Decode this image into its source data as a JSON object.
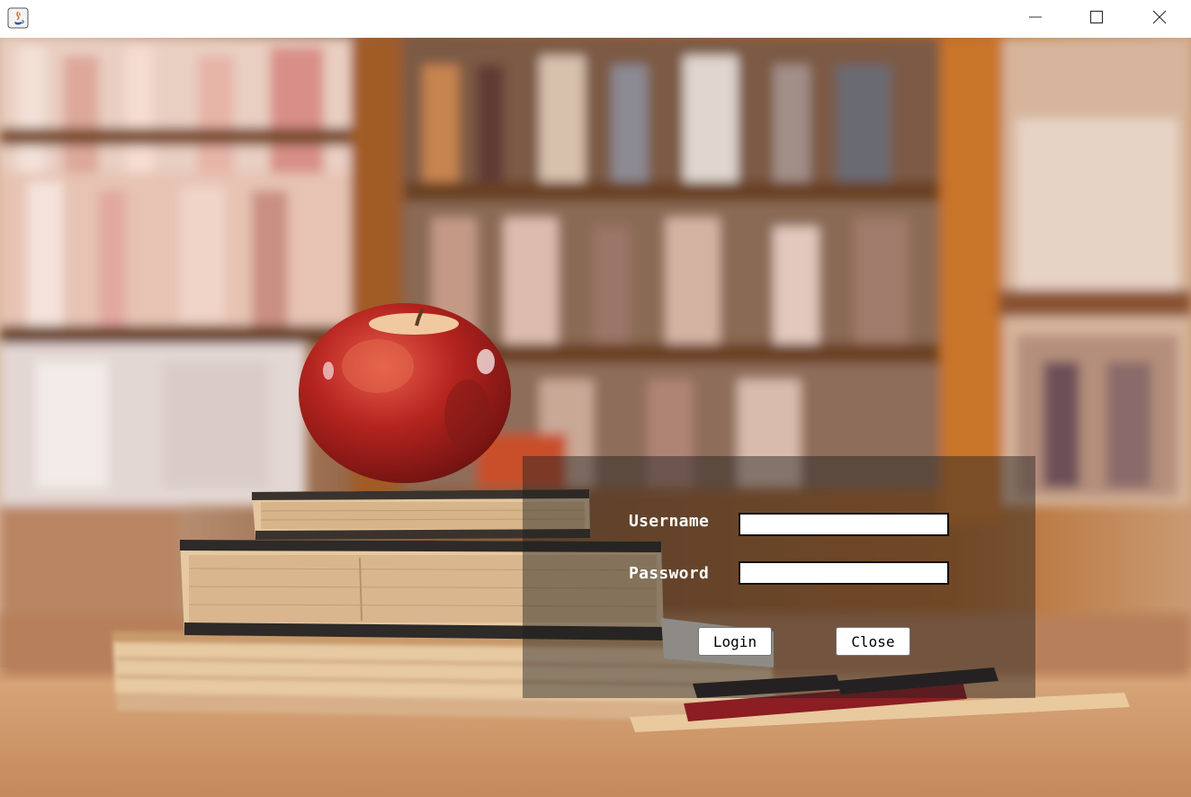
{
  "window": {
    "title": "",
    "controls": {
      "minimize_icon": "minimize-icon",
      "maximize_icon": "maximize-icon",
      "close_icon": "close-icon"
    }
  },
  "background": {
    "description_icon": "library-background"
  },
  "login": {
    "username_label": "Username",
    "username_value": "",
    "password_label": "Password",
    "password_value": "",
    "login_button": "Login",
    "close_button": "Close"
  },
  "colors": {
    "panel": "#1e1e1e",
    "text": "#ffffff"
  }
}
